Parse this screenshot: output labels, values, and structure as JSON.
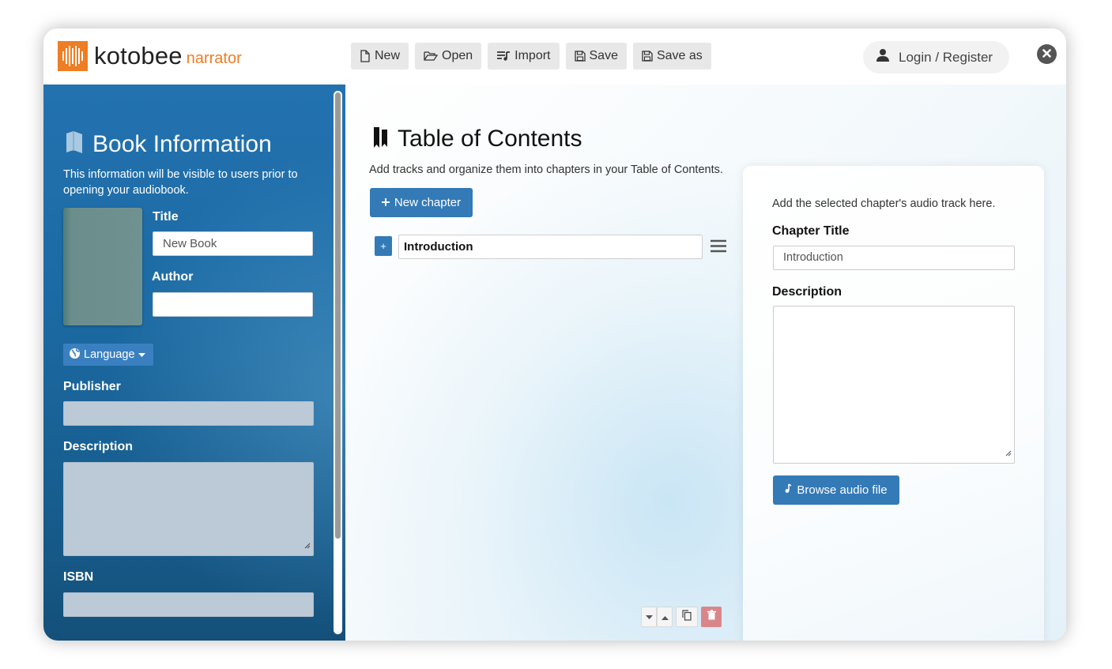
{
  "app": {
    "logo_text": "kotobee",
    "logo_sub": "narrator",
    "brand_color": "#ee7d24",
    "accent_color": "#337ab7"
  },
  "toolbar": {
    "new_label": "New",
    "open_label": "Open",
    "import_label": "Import",
    "save_label": "Save",
    "save_as_label": "Save as",
    "icons": [
      "file-icon",
      "folder-open-icon",
      "playlist-icon",
      "floppy-icon",
      "floppy-icon"
    ]
  },
  "account": {
    "login_label": "Login / Register"
  },
  "book_info": {
    "title": "Book Information",
    "description": "This information will be visible to users prior to opening your audiobook.",
    "title_label": "Title",
    "title_placeholder": "New Book",
    "author_label": "Author",
    "author_value": "",
    "language_label": "Language",
    "publisher_label": "Publisher",
    "description_label": "Description",
    "isbn_label": "ISBN"
  },
  "toc": {
    "title": "Table of Contents",
    "description": "Add tracks and organize them into chapters in your Table of Contents.",
    "new_chapter_label": "New chapter",
    "chapters": [
      {
        "plus": "+",
        "title": "Introduction"
      }
    ]
  },
  "chapter_panel": {
    "hint": "Add the selected chapter's audio track here.",
    "chapter_title_label": "Chapter Title",
    "chapter_title_placeholder": "Introduction",
    "description_label": "Description",
    "browse_label": "Browse audio file"
  }
}
